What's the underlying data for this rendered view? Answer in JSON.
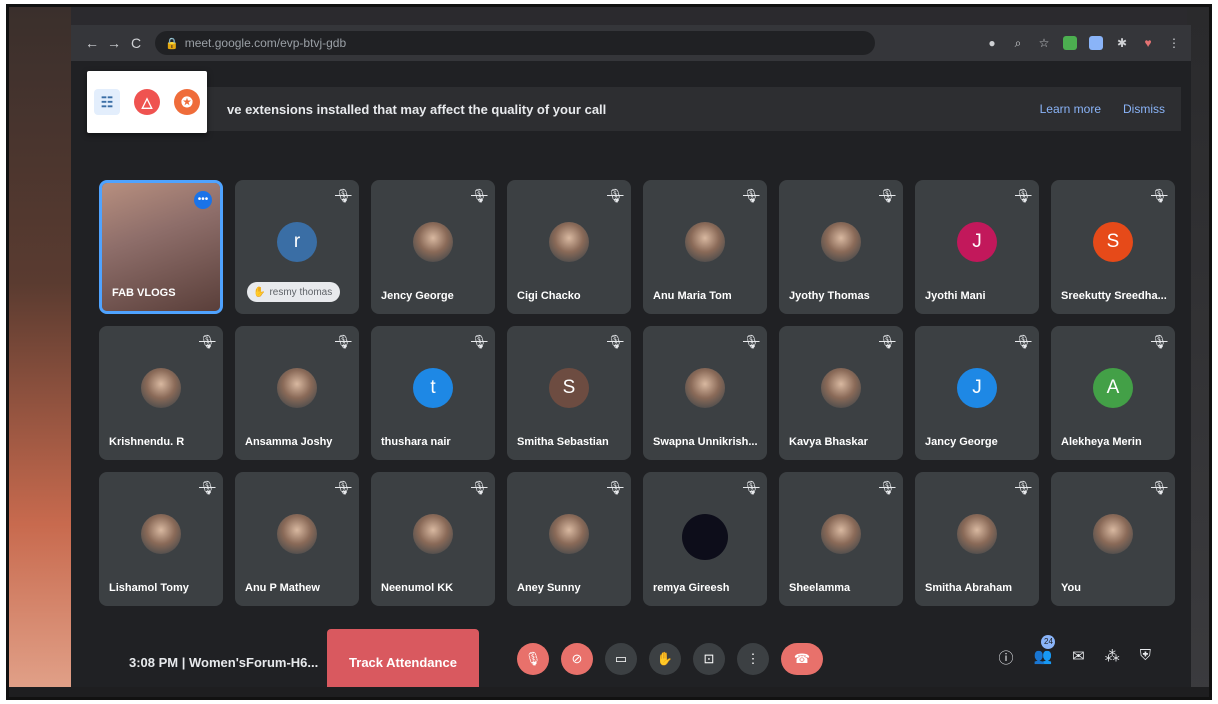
{
  "browser": {
    "url": "meet.google.com/evp-btvj-gdb"
  },
  "banner": {
    "text": "ve extensions installed that may affect the quality of your call",
    "learn_more": "Learn more",
    "dismiss": "Dismiss"
  },
  "tiles": [
    {
      "name": "FAB VLOGS",
      "kind": "self"
    },
    {
      "name": "resmy thomas",
      "kind": "letter",
      "letter": "r",
      "color": "#3a6ea5",
      "speaking": true
    },
    {
      "name": "Jency George",
      "kind": "photo"
    },
    {
      "name": "Cigi Chacko",
      "kind": "photo"
    },
    {
      "name": "Anu Maria Tom",
      "kind": "photo"
    },
    {
      "name": "Jyothy Thomas",
      "kind": "photo"
    },
    {
      "name": "Jyothi Mani",
      "kind": "letter",
      "letter": "J",
      "color": "#c2185b"
    },
    {
      "name": "Sreekutty Sreedha...",
      "kind": "letter",
      "letter": "S",
      "color": "#e64a19"
    },
    {
      "name": "Krishnendu. R",
      "kind": "photo"
    },
    {
      "name": "Ansamma Joshy",
      "kind": "photo"
    },
    {
      "name": "thushara nair",
      "kind": "letter",
      "letter": "t",
      "color": "#1e88e5"
    },
    {
      "name": "Smitha Sebastian",
      "kind": "letter",
      "letter": "S",
      "color": "#6d4c41"
    },
    {
      "name": "Swapna Unnikrish...",
      "kind": "photo"
    },
    {
      "name": "Kavya Bhaskar",
      "kind": "photo"
    },
    {
      "name": "Jancy George",
      "kind": "letter",
      "letter": "J",
      "color": "#1e88e5"
    },
    {
      "name": "Alekheya Merin",
      "kind": "letter",
      "letter": "A",
      "color": "#43a047"
    },
    {
      "name": "Lishamol Tomy",
      "kind": "photo"
    },
    {
      "name": "Anu P Mathew",
      "kind": "photo"
    },
    {
      "name": "Neenumol KK",
      "kind": "photo"
    },
    {
      "name": "Aney Sunny",
      "kind": "photo"
    },
    {
      "name": "remya Gireesh",
      "kind": "dark"
    },
    {
      "name": "Sheelamma",
      "kind": "photo"
    },
    {
      "name": "Smitha Abraham",
      "kind": "photo"
    },
    {
      "name": "You",
      "kind": "photo"
    }
  ],
  "bottom": {
    "meeting_info": "3:08 PM  |  Women'sForum-H6...",
    "track_attendance": "Track Attendance",
    "participant_count": "24"
  }
}
